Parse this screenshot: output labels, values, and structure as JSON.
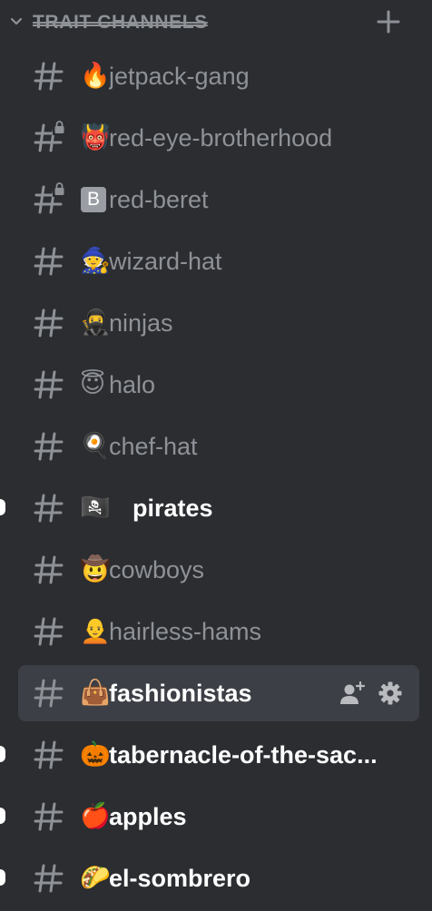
{
  "category": {
    "label": "TRAIT CHANNELS",
    "chevron_icon": "chevron-down-icon",
    "add_icon": "plus-icon"
  },
  "channels": [
    {
      "name": "jetpack-gang",
      "emoji": "🔥",
      "locked": false,
      "unread": false,
      "selected": false
    },
    {
      "name": "red-eye-brotherhood",
      "emoji": "👹",
      "locked": true,
      "unread": false,
      "selected": false
    },
    {
      "name": "red-beret",
      "emoji": "🅱",
      "locked": true,
      "unread": false,
      "selected": false
    },
    {
      "name": "wizard-hat",
      "emoji": "🧙",
      "locked": false,
      "unread": false,
      "selected": false
    },
    {
      "name": "ninjas",
      "emoji": "🥷",
      "locked": false,
      "unread": false,
      "selected": false
    },
    {
      "name": "halo",
      "emoji": "😇",
      "locked": false,
      "unread": false,
      "selected": false
    },
    {
      "name": "chef-hat",
      "emoji": "🍳",
      "locked": false,
      "unread": false,
      "selected": false
    },
    {
      "name": "pirates",
      "emoji": "🏴‍☠️",
      "locked": false,
      "unread": true,
      "selected": false
    },
    {
      "name": "cowboys",
      "emoji": "🤠",
      "locked": false,
      "unread": false,
      "selected": false
    },
    {
      "name": "hairless-hams",
      "emoji": "🧑‍🦲",
      "locked": false,
      "unread": false,
      "selected": false
    },
    {
      "name": "fashionistas",
      "emoji": "👜",
      "locked": false,
      "unread": false,
      "selected": true
    },
    {
      "name": "tabernacle-of-the-sac...",
      "emoji": "🎃",
      "locked": false,
      "unread": true,
      "selected": false
    },
    {
      "name": "apples",
      "emoji": "🍎",
      "locked": false,
      "unread": true,
      "selected": false
    },
    {
      "name": "el-sombrero",
      "emoji": "🌮",
      "locked": false,
      "unread": true,
      "selected": false
    }
  ],
  "selected_actions": {
    "invite_icon": "add-member-icon",
    "settings_icon": "gear-icon"
  },
  "colors": {
    "background": "#2b2d31",
    "muted_text": "#8e9297",
    "active_text": "#ffffff",
    "selected_bg": "#3c3f45"
  }
}
